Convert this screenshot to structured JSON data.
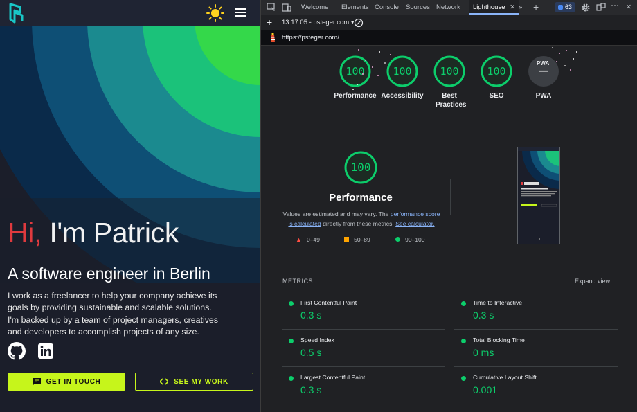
{
  "site": {
    "greeting_hi": "Hi,",
    "greeting_name": "I'm Patrick",
    "tagline": "A software engineer in Berlin",
    "intro": "I work as a freelancer to help your company achieve its goals by providing sustainable and scalable solutions. I'm backed up by a team of project managers, creatives and developers to accomplish projects of any size.",
    "cta_primary": "GET IN TOUCH",
    "cta_secondary": "SEE MY WORK",
    "icons": [
      "logo-icon",
      "sun-icon",
      "menu-icon",
      "github-icon",
      "linkedin-icon",
      "chat-icon",
      "code-icon"
    ]
  },
  "devtools": {
    "tabs": [
      "Welcome",
      "Elements",
      "Console",
      "Sources",
      "Network",
      "Lighthouse"
    ],
    "active_tab": "Lighthouse",
    "issues_count": "63",
    "report_time": "13:17:05 - psteger.com",
    "url": "https://psteger.com/",
    "categories": [
      {
        "score": "100",
        "label": "Performance",
        "level": 1.0
      },
      {
        "score": "100",
        "label": "Accessibility",
        "level": 1.0
      },
      {
        "score": "100",
        "label": "Best Practices",
        "level": 1.0
      },
      {
        "score": "100",
        "label": "SEO",
        "level": 1.0
      },
      {
        "score": "–",
        "label": "PWA",
        "level": 0
      }
    ],
    "pwa_badge": "PWA",
    "performance": {
      "score": "100",
      "title": "Performance",
      "desc_prefix": "Values are estimated and may vary. The ",
      "desc_link1": "performance score is calculated",
      "desc_middle": " directly from these metrics. ",
      "desc_link2": "See calculator.",
      "legend": [
        "0–49",
        "50–89",
        "90–100"
      ]
    },
    "metrics_heading": "METRICS",
    "expand_view": "Expand view",
    "metrics": [
      {
        "name": "First Contentful Paint",
        "value": "0.3 s"
      },
      {
        "name": "Time to Interactive",
        "value": "0.3 s"
      },
      {
        "name": "Speed Index",
        "value": "0.5 s"
      },
      {
        "name": "Total Blocking Time",
        "value": "0 ms"
      },
      {
        "name": "Largest Contentful Paint",
        "value": "0.3 s"
      },
      {
        "name": "Cumulative Layout Shift",
        "value": "0.001"
      }
    ],
    "colors": {
      "pass": "#0cce6b",
      "average": "#ffa400",
      "fail": "#ff4e42",
      "accent": "#c6f51b"
    }
  }
}
